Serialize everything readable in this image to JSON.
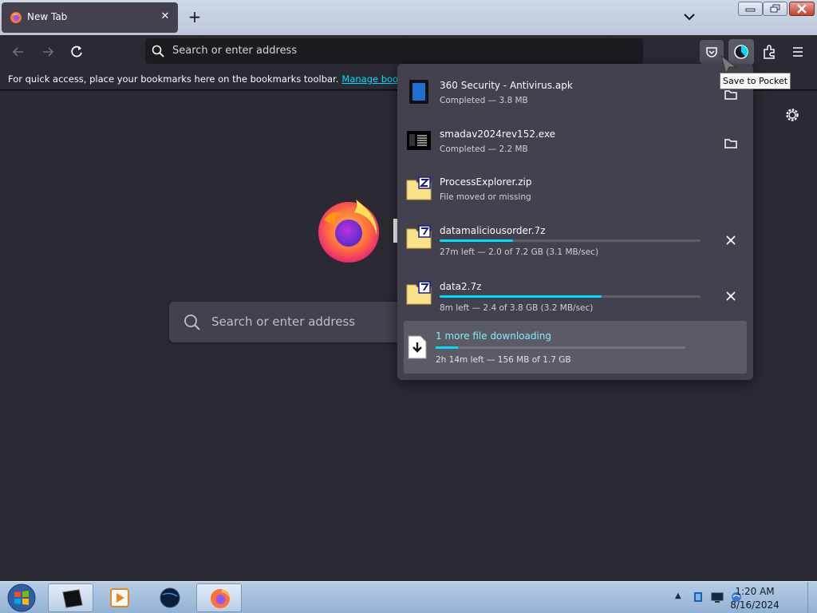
{
  "tab": {
    "title": "New Tab",
    "close": "✕"
  },
  "tabstrip": {
    "new_tab": "+"
  },
  "urlbar": {
    "placeholder": "Search or enter address"
  },
  "bookmarks": {
    "message": "For quick access, place your bookmarks here on the bookmarks toolbar.",
    "manage_link": "Manage bookmarks…"
  },
  "newtab_page": {
    "search_placeholder": "Search or enter address"
  },
  "downloads": {
    "items": [
      {
        "name": "360 Security - Antivirus.apk",
        "status": "Completed — 3.8 MB",
        "icon": "apk-file-icon",
        "action": "folder-icon"
      },
      {
        "name": "smadav2024rev152.exe",
        "status": "Completed — 2.2 MB",
        "icon": "exe-file-icon",
        "action": "folder-icon"
      },
      {
        "name": "ProcessExplorer.zip",
        "status": "File moved or missing",
        "icon": "zip-file-icon"
      },
      {
        "name": "datamaliciousorder.7z",
        "status": "27m left — 2.0 of 7.2 GB (3.1 MB/sec)",
        "progress": 0.28,
        "icon": "7z-file-icon",
        "action": "cancel-icon"
      },
      {
        "name": "data2.7z",
        "status": "8m left — 2.4 of 3.8 GB (3.2 MB/sec)",
        "progress": 0.62,
        "icon": "7z-file-icon",
        "action": "cancel-icon"
      }
    ],
    "more": {
      "label": "1 more file downloading",
      "status": "2h 14m left — 156 MB of 1.7 GB",
      "progress": 0.09
    }
  },
  "tooltip": "Save to Pocket",
  "clock": {
    "time": "1:20 AM",
    "date": "8/16/2024"
  },
  "colors": {
    "accent": "#00ddff",
    "panel": "#42414d",
    "toolbar": "#2b2a33",
    "background": "#1c1b22"
  }
}
